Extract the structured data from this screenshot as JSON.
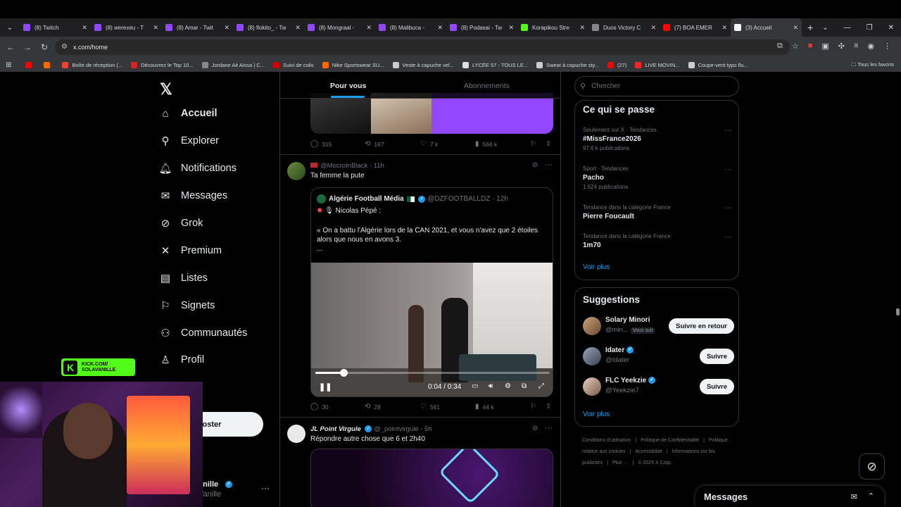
{
  "browser": {
    "tabs": [
      {
        "title": "(8) Twitch",
        "color": "#9146ff"
      },
      {
        "title": "(8) werexeu - T",
        "color": "#9146ff"
      },
      {
        "title": "(8) Amar - Twit",
        "color": "#9146ff"
      },
      {
        "title": "(8) flokito_ - Tw",
        "color": "#9146ff"
      },
      {
        "title": "(8) Mongraal -",
        "color": "#9146ff"
      },
      {
        "title": "(8) Malibuca -",
        "color": "#9146ff"
      },
      {
        "title": "(8) Podasai - Tw",
        "color": "#9146ff"
      },
      {
        "title": "Korapikou Stre",
        "color": "#53fc18"
      },
      {
        "title": "Duos Victory C",
        "color": "#888888"
      },
      {
        "title": "(7) BOA EMER",
        "color": "#ff0000"
      },
      {
        "title": "(3) Accueil",
        "color": "#ffffff",
        "active": true
      }
    ],
    "url": "x.com/home",
    "bookmarks": [
      {
        "label": "",
        "color": "#ff0000"
      },
      {
        "label": "",
        "color": "#ff6a00"
      },
      {
        "label": "Boîte de réception (...",
        "color": "#ea4335"
      },
      {
        "label": "Découvrez le Top 10...",
        "color": "#d32323"
      },
      {
        "label": "Jordane Ait Aissa | C...",
        "color": "#888888"
      },
      {
        "label": "Suivi de colis",
        "color": "#d40000"
      },
      {
        "label": "Nike Sportswear SU...",
        "color": "#ff6a00"
      },
      {
        "label": "Veste à capuche vel...",
        "color": "#cccccc"
      },
      {
        "label": "LYCÉE 57 - TOUS LE...",
        "color": "#dddddd"
      },
      {
        "label": "Sweat à capuche sty...",
        "color": "#cccccc"
      },
      {
        "label": "(27)",
        "color": "#ff0000"
      },
      {
        "label": "LIVE MOVIN...",
        "color": "#ff2222"
      },
      {
        "label": "Coupe-vent typo flu...",
        "color": "#cccccc"
      }
    ],
    "all_bookmarks": "Tous les favoris"
  },
  "sidebar": {
    "items": [
      {
        "label": "Accueil",
        "icon": "home-icon",
        "glyph": "⌂",
        "bold": true
      },
      {
        "label": "Explorer",
        "icon": "search-icon",
        "glyph": "⚲"
      },
      {
        "label": "Notifications",
        "icon": "bell-icon",
        "glyph": "🔔︎"
      },
      {
        "label": "Messages",
        "icon": "mail-icon",
        "glyph": "✉"
      },
      {
        "label": "Grok",
        "icon": "grok-icon",
        "glyph": "⊘"
      },
      {
        "label": "Premium",
        "icon": "x-premium-icon",
        "glyph": "✕"
      },
      {
        "label": "Listes",
        "icon": "list-icon",
        "glyph": "▤"
      },
      {
        "label": "Signets",
        "icon": "bookmark-icon",
        "glyph": "⚐"
      },
      {
        "label": "Communautés",
        "icon": "communities-icon",
        "glyph": "⚇"
      },
      {
        "label": "Profil",
        "icon": "profile-icon",
        "glyph": "♙"
      }
    ],
    "post_button": "oster",
    "account": {
      "name": "anille",
      "handle": "Vanille"
    }
  },
  "overlay": {
    "kick_label": "KICK.COM/",
    "kick_name": "SOLAVANILLE"
  },
  "feed": {
    "tabs": {
      "for_you": "Pour vous",
      "following": "Abonnements"
    },
    "post1_actions": {
      "replies": "315",
      "reposts": "167",
      "likes": "7 k",
      "views": "566 k"
    },
    "post2": {
      "handle": "@MocroInBlack",
      "time": "· 11h",
      "text": "Ta femme la pute",
      "quote": {
        "name": "Algérie Football Média",
        "handle": "@DZFOOTBALLDZ",
        "time": "· 12h",
        "sub": "Nicolas Pépé :",
        "body": "« On a battu l'Algérie lors de la CAN 2021, et vous n'avez que 2 étoiles alors que nous en avons 3.",
        "ellipsis": "..."
      },
      "video": {
        "time": "0:04 / 0:34",
        "progress": 0.12
      },
      "actions": {
        "replies": "30",
        "reposts": "28",
        "likes": "561",
        "views": "44 k"
      }
    },
    "post3": {
      "name": "JL Point Virgule",
      "handle": "@_pointvirgule",
      "time": "· 5h",
      "text": "Répondre autre chose que 6 et 2h40"
    }
  },
  "right": {
    "search_placeholder": "Chercher",
    "trends_title": "Ce qui se passe",
    "trends": [
      {
        "meta": "Seulement sur X · Tendances",
        "name": "#MissFrance2026",
        "count": "97,6 k publications"
      },
      {
        "meta": "Sport · Tendances",
        "name": "Pacho",
        "count": "1 624 publications"
      },
      {
        "meta": "Tendance dans la catégorie France",
        "name": "Pierre Foucault",
        "count": ""
      },
      {
        "meta": "Tendance dans la catégorie France",
        "name": "1m70",
        "count": ""
      }
    ],
    "see_more": "Voir plus",
    "suggestions_title": "Suggestions",
    "suggestions": [
      {
        "name": "Solary Minori",
        "handle": "@min...",
        "badge": "Vous suit",
        "button": "Suivre en retour"
      },
      {
        "name": "Idater",
        "handle": "@Idater",
        "badge": "",
        "button": "Suivre"
      },
      {
        "name": "FLC Yeekzie",
        "handle": "@Yeekzie7",
        "badge": "",
        "button": "Suivre"
      }
    ],
    "see_more2": "Voir plus",
    "footer": [
      "Conditions d'utilisation",
      "|",
      "Politique de Confidentialité",
      "|",
      "Politique relative aux cookies",
      "|",
      "Accessibilité",
      "|",
      "Informations sur les publicités",
      "|",
      "Plus ···",
      "|",
      "© 2025 X Corp."
    ]
  },
  "messages_dock": "Messages"
}
